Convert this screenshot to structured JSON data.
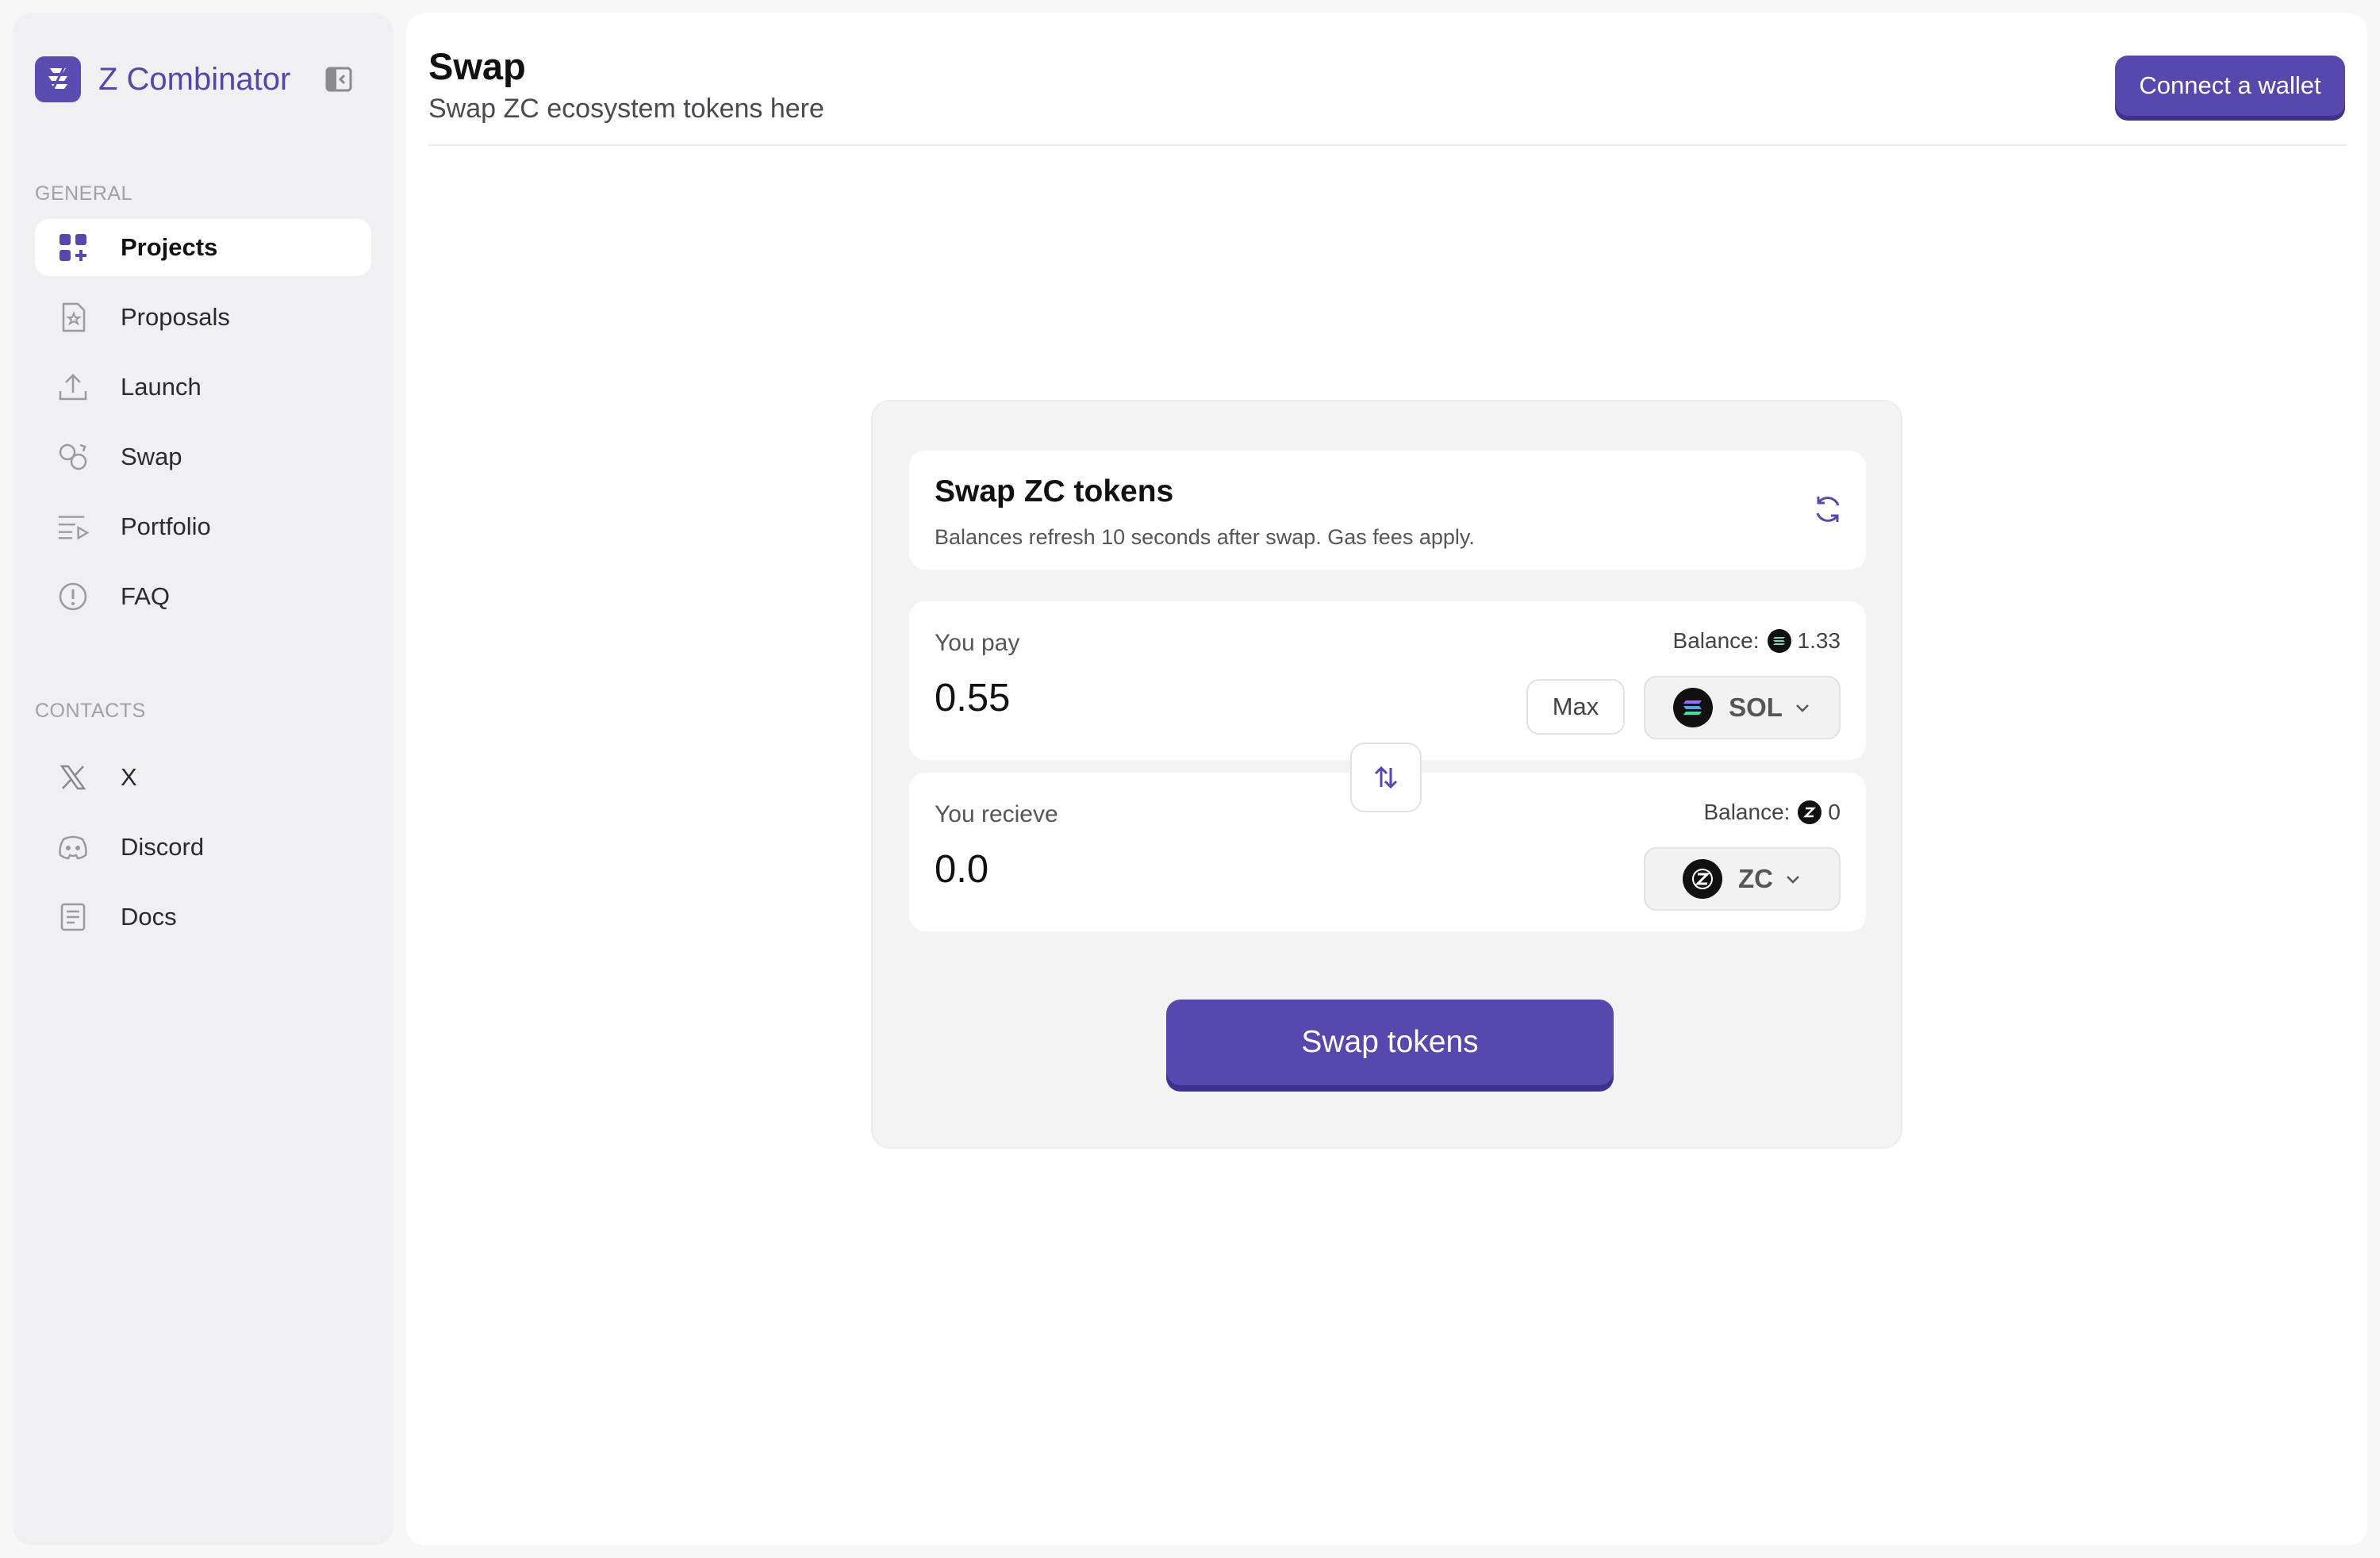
{
  "brand": {
    "name": "Z Combinator"
  },
  "sidebar": {
    "general_label": "GENERAL",
    "general_items": [
      {
        "label": "Projects",
        "icon": "grid-plus-icon",
        "active": true
      },
      {
        "label": "Proposals",
        "icon": "document-star-icon"
      },
      {
        "label": "Launch",
        "icon": "upload-icon"
      },
      {
        "label": "Swap",
        "icon": "swap-circles-icon"
      },
      {
        "label": "Portfolio",
        "icon": "list-play-icon"
      },
      {
        "label": "FAQ",
        "icon": "alert-circle-icon"
      }
    ],
    "contacts_label": "CONTACTS",
    "contact_items": [
      {
        "label": "X",
        "icon": "x-icon"
      },
      {
        "label": "Discord",
        "icon": "discord-icon"
      },
      {
        "label": "Docs",
        "icon": "document-lines-icon"
      }
    ]
  },
  "header": {
    "title": "Swap",
    "subtitle": "Swap ZC ecosystem tokens here",
    "connect_label": "Connect a wallet"
  },
  "swap": {
    "title": "Swap ZC tokens",
    "info": "Balances refresh 10 seconds after swap. Gas fees apply.",
    "pay": {
      "label": "You pay",
      "balance_label": "Balance:",
      "balance_value": "1.33",
      "amount": "0.55",
      "max_label": "Max",
      "token": "SOL"
    },
    "receive": {
      "label": "You recieve",
      "balance_label": "Balance:",
      "balance_value": "0",
      "amount": "0.0",
      "token": "ZC"
    },
    "button_label": "Swap tokens"
  },
  "colors": {
    "accent": "#5648ad",
    "accent_text": "#5646ab",
    "sidebar_bg": "#f0f0f2",
    "card_bg": "#f3f3f4"
  }
}
